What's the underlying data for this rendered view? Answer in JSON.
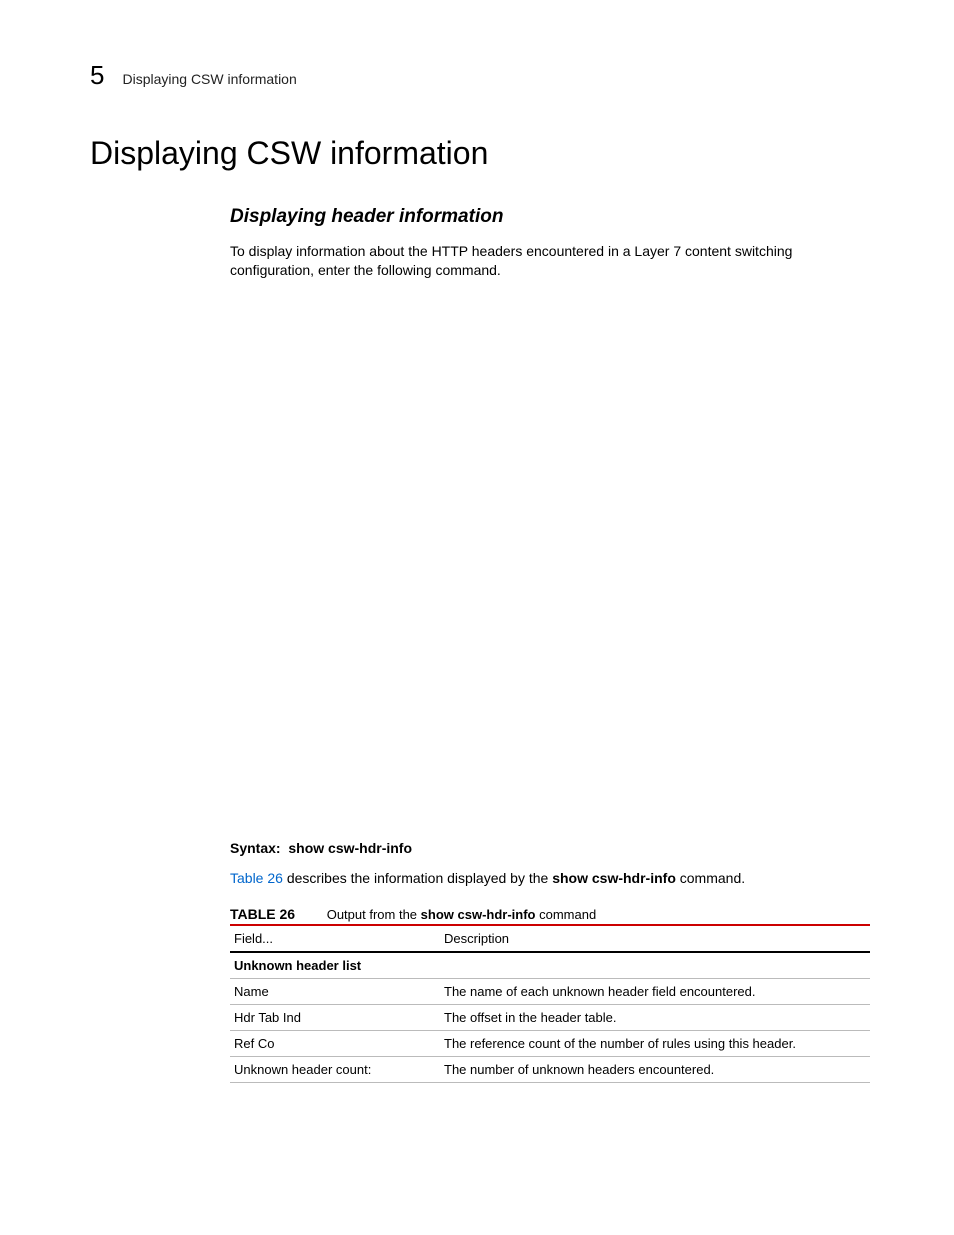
{
  "header": {
    "chapter_number": "5",
    "running_title": "Displaying CSW information"
  },
  "section": {
    "title": "Displaying CSW information",
    "subheading": "Displaying header information",
    "intro": "To display information about the HTTP headers encountered in a Layer 7 content switching configuration, enter the following command."
  },
  "syntax": {
    "label": "Syntax:",
    "command": "show csw-hdr-info"
  },
  "describe": {
    "link_text": "Table 26",
    "mid": " describes the information displayed by the ",
    "bold_cmd": "show csw-hdr-info",
    "tail": " command."
  },
  "table": {
    "label": "TABLE 26",
    "caption_pre": "Output from the ",
    "caption_bold": "show csw-hdr-info",
    "caption_post": " command",
    "columns": {
      "field": "Field...",
      "desc": "Description"
    },
    "section_label": "Unknown header list",
    "rows": [
      {
        "field": "Name",
        "desc": "The name of each unknown header field encountered."
      },
      {
        "field": "Hdr Tab Ind",
        "desc": "The offset in the header table."
      },
      {
        "field": "Ref Co",
        "desc": "The reference count of the number of rules using this header."
      },
      {
        "field": "Unknown header count:",
        "desc": "The number of unknown headers encountered."
      }
    ]
  }
}
